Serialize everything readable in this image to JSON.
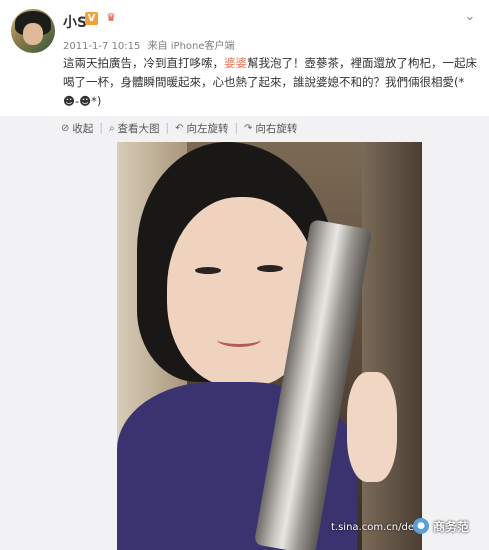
{
  "header": {
    "username": "小S",
    "verified_badge": "V",
    "vip_icon": "vip-crown-icon",
    "menu_icon": "chevron-down-icon",
    "date": "2011-1-7 10:15",
    "source": "来自 iPhone客户端"
  },
  "post": {
    "text_part1": "這兩天拍廣告，冷到直打哆嗦，",
    "mention": "婆婆",
    "text_part2": "幫我泡了！壺蔘茶，裡面還放了枸杞，一起床喝了一杯，身體瞬間暖起來，心也熱了起來，誰說婆媳不和的？我們倆很相愛(*",
    "text_emoji": "☻-☻*)"
  },
  "toolbar": {
    "collapse": "收起",
    "view_large": "查看大图",
    "rotate_left": "向左旋转",
    "rotate_right": "向右旋转"
  },
  "photo": {
    "watermark": "t.sina.com.cn/dees",
    "brand_label": "商务范"
  },
  "colors": {
    "mention": "#eb7350",
    "toolbar_bg": "#f2f2f5",
    "vbadge": "#f2a13a"
  }
}
